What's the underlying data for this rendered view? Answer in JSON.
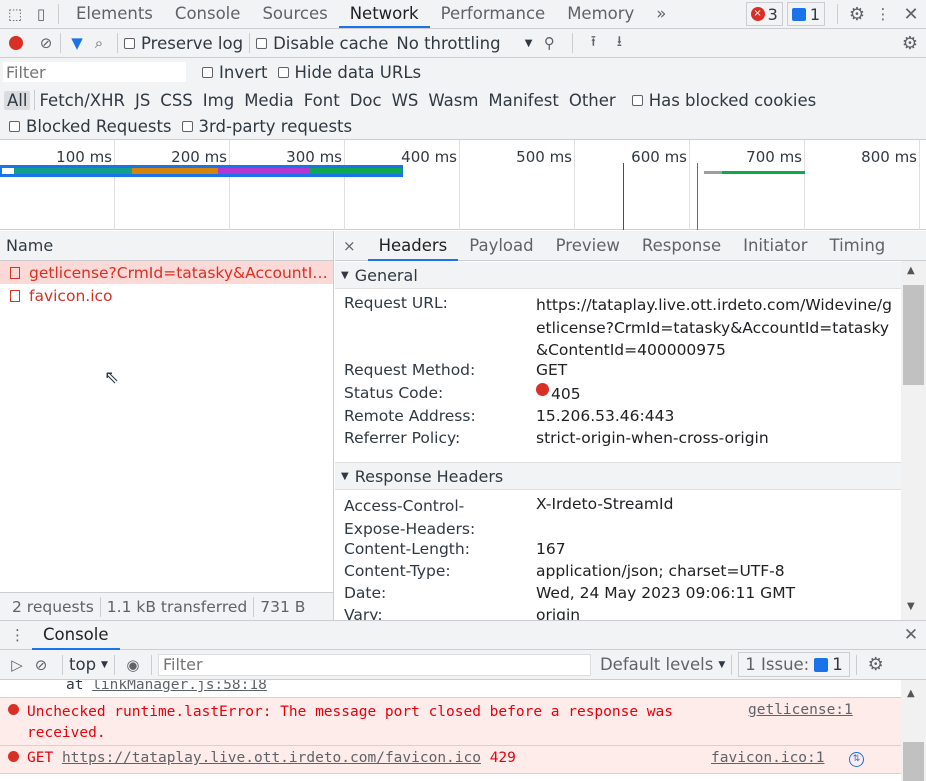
{
  "tabs": [
    "Elements",
    "Console",
    "Sources",
    "Network",
    "Performance",
    "Memory"
  ],
  "more": "»",
  "error_count": "3",
  "message_count": "1",
  "toolbar": {
    "preserve_log": "Preserve log",
    "disable_cache": "Disable cache",
    "throttling": "No throttling"
  },
  "filter": {
    "placeholder": "Filter",
    "invert": "Invert",
    "hide_data_urls": "Hide data URLs"
  },
  "types": [
    "All",
    "Fetch/XHR",
    "JS",
    "CSS",
    "Img",
    "Media",
    "Font",
    "Doc",
    "WS",
    "Wasm",
    "Manifest",
    "Other"
  ],
  "has_blocked_cookies": "Has blocked cookies",
  "blocked_requests": "Blocked Requests",
  "third_party": "3rd-party requests",
  "timeline_ticks": [
    "100 ms",
    "200 ms",
    "300 ms",
    "400 ms",
    "500 ms",
    "600 ms",
    "700 ms",
    "800 ms"
  ],
  "name_header": "Name",
  "requests": [
    {
      "name": "getlicense?CrmId=tatasky&AccountId=tatasky&ContentId=400000975"
    },
    {
      "name": "favicon.ico"
    }
  ],
  "status": {
    "requests": "2 requests",
    "transferred": "1.1 kB transferred",
    "resources": "731 B"
  },
  "detail_tabs": [
    "Headers",
    "Payload",
    "Preview",
    "Response",
    "Initiator",
    "Timing"
  ],
  "close": "×",
  "general": {
    "title": "General",
    "items": [
      {
        "k": "Request URL:",
        "v": "https://tataplay.live.ott.irdeto.com/Widevine/getlicense?CrmId=tatasky&AccountId=tatasky&ContentId=400000975"
      },
      {
        "k": "Request Method:",
        "v": "GET"
      },
      {
        "k": "Status Code:",
        "v": "405"
      },
      {
        "k": "Remote Address:",
        "v": "15.206.53.46:443"
      },
      {
        "k": "Referrer Policy:",
        "v": "strict-origin-when-cross-origin"
      }
    ]
  },
  "response_headers": {
    "title": "Response Headers",
    "items": [
      {
        "k": "Access-Control-Expose-Headers:",
        "v": "X-Irdeto-StreamId"
      },
      {
        "k": "Content-Length:",
        "v": "167"
      },
      {
        "k": "Content-Type:",
        "v": "application/json; charset=UTF-8"
      },
      {
        "k": "Date:",
        "v": "Wed, 24 May 2023 09:06:11 GMT"
      },
      {
        "k": "Vary:",
        "v": "origin"
      }
    ]
  },
  "console": {
    "tab": "Console",
    "context": "top",
    "filter_placeholder": "Filter",
    "levels": "Default levels",
    "issues": "1 Issue:",
    "issues_count": "1",
    "messages": [
      {
        "text": "at ",
        "link": "linkManager.js:58:18"
      },
      {
        "text": "Unchecked runtime.lastError: The message port closed before a response was received.",
        "source": "getlicense:1"
      },
      {
        "text": "GET",
        "url": "https://tataplay.live.ott.irdeto.com/favicon.ico",
        "code": "429",
        "source": "favicon.ico:1"
      }
    ]
  }
}
